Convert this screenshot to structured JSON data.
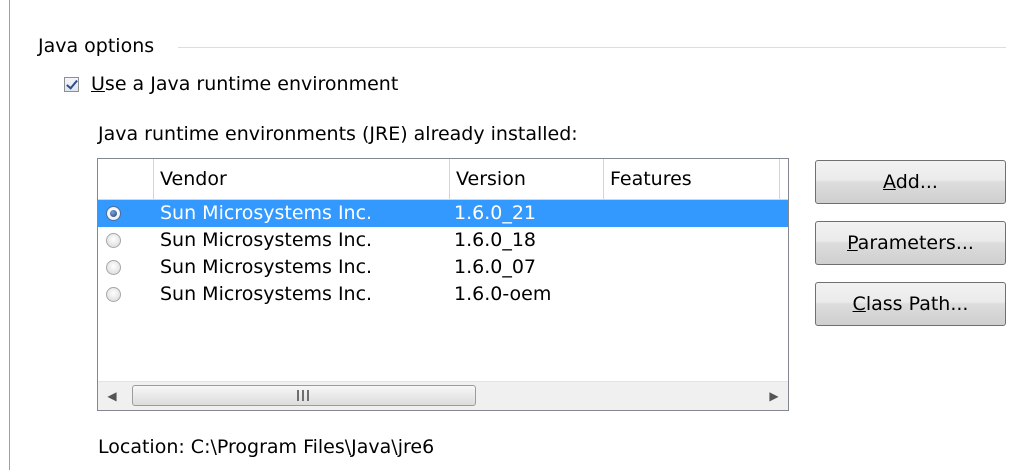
{
  "group": {
    "title": "Java options"
  },
  "use_jre": {
    "checked": true,
    "label_first": "U",
    "label_rest": "se a Java runtime environment"
  },
  "jre_list": {
    "label_first": "J",
    "label_rest": "ava runtime environments (JRE) already installed:",
    "headers": {
      "vendor": "Vendor",
      "version": "Version",
      "features": "Features"
    },
    "rows": [
      {
        "vendor": "Sun Microsystems Inc.",
        "version": "1.6.0_21",
        "selected": true
      },
      {
        "vendor": "Sun Microsystems Inc.",
        "version": "1.6.0_18",
        "selected": false
      },
      {
        "vendor": "Sun Microsystems Inc.",
        "version": "1.6.0_07",
        "selected": false
      },
      {
        "vendor": "Sun Microsystems Inc.",
        "version": "1.6.0-oem",
        "selected": false
      }
    ]
  },
  "buttons": {
    "add": {
      "first": "A",
      "rest": "dd..."
    },
    "parameters": {
      "first": "P",
      "rest": "arameters..."
    },
    "class_path": {
      "first": "C",
      "rest": "lass Path..."
    }
  },
  "location": "Location: C:\\Program Files\\Java\\jre6",
  "icons": {
    "scroll_left": "chevron-left-icon",
    "scroll_right": "chevron-right-icon",
    "radio": "radio-button-icon",
    "checkbox": "checkbox-icon"
  },
  "colors": {
    "selection": "#3399ff"
  }
}
